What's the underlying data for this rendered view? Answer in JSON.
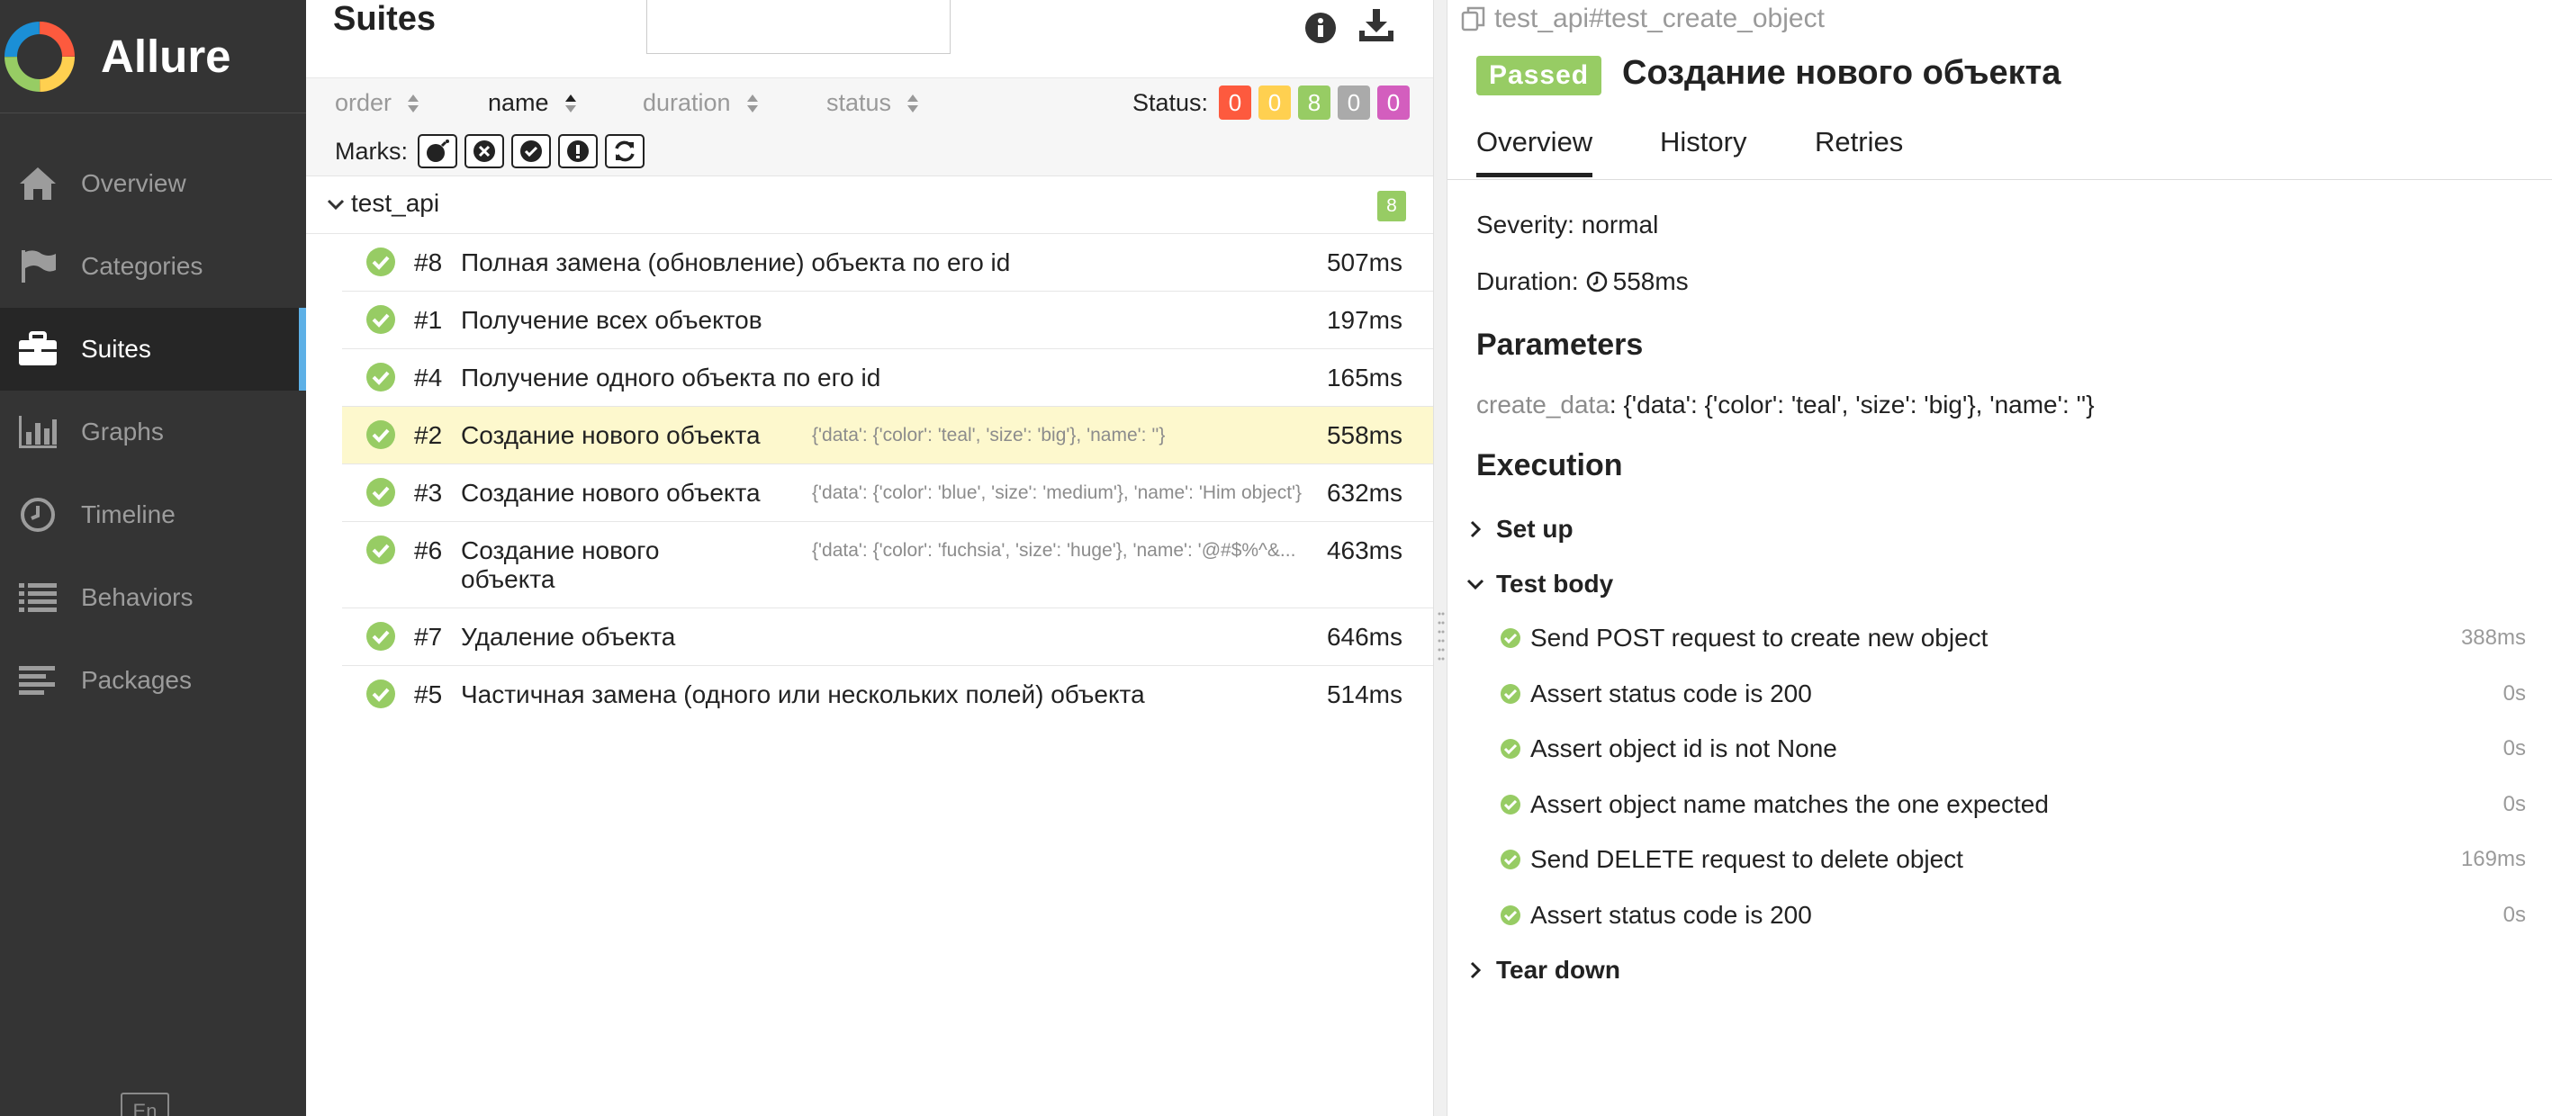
{
  "app": {
    "name": "Allure"
  },
  "sidebar": {
    "items": [
      {
        "label": "Overview",
        "icon": "home-icon",
        "active": false
      },
      {
        "label": "Categories",
        "icon": "flag-icon",
        "active": false
      },
      {
        "label": "Suites",
        "icon": "briefcase-icon",
        "active": true
      },
      {
        "label": "Graphs",
        "icon": "bar-chart-icon",
        "active": false
      },
      {
        "label": "Timeline",
        "icon": "clock-icon",
        "active": false
      },
      {
        "label": "Behaviors",
        "icon": "list-icon",
        "active": false
      },
      {
        "label": "Packages",
        "icon": "align-left-icon",
        "active": false
      }
    ],
    "language": "En"
  },
  "suites": {
    "title": "Suites",
    "sort": {
      "order": "order",
      "name": "name",
      "duration": "duration",
      "status": "status",
      "active": "name"
    },
    "status_label": "Status:",
    "status_counts": [
      {
        "key": "failed",
        "value": "0",
        "color": "#fd5a3e"
      },
      {
        "key": "broken",
        "value": "0",
        "color": "#ffd050"
      },
      {
        "key": "passed",
        "value": "8",
        "color": "#97cc64"
      },
      {
        "key": "skipped",
        "value": "0",
        "color": "#aaaaaa"
      },
      {
        "key": "unknown",
        "value": "0",
        "color": "#d35ebe"
      }
    ],
    "marks_label": "Marks:",
    "marks": [
      "flaky-bomb-icon",
      "times-circle-icon",
      "check-circle-icon",
      "exclamation-circle-icon",
      "refresh-icon"
    ],
    "group": {
      "name": "test_api",
      "count": "8"
    },
    "tests": [
      {
        "num": "#8",
        "name": "Полная замена (обновление) объекта по его id",
        "params": "",
        "duration": "507ms"
      },
      {
        "num": "#1",
        "name": "Получение всех объектов",
        "params": "",
        "duration": "197ms"
      },
      {
        "num": "#4",
        "name": "Получение одного объекта по его id",
        "params": "",
        "duration": "165ms"
      },
      {
        "num": "#2",
        "name": "Создание нового объекта",
        "params": "{'data': {'color': 'teal', 'size': 'big'}, 'name': ''}",
        "duration": "558ms",
        "selected": true
      },
      {
        "num": "#3",
        "name": "Создание нового объекта",
        "params": "{'data': {'color': 'blue', 'size': 'medium'}, 'name': 'Him object'}",
        "duration": "632ms"
      },
      {
        "num": "#6",
        "name": "Создание нового объекта",
        "params": "{'data': {'color': 'fuchsia', 'size': 'huge'}, 'name': '@#$%^&...",
        "duration": "463ms"
      },
      {
        "num": "#7",
        "name": "Удаление объекта",
        "params": "",
        "duration": "646ms"
      },
      {
        "num": "#5",
        "name": "Частичная замена (одного или нескольких полей) объекта",
        "params": "",
        "duration": "514ms"
      }
    ]
  },
  "detail": {
    "path": "test_api#test_create_object",
    "status": "Passed",
    "title": "Создание нового объекта",
    "tabs": [
      "Overview",
      "History",
      "Retries"
    ],
    "severity_label": "Severity:",
    "severity": "normal",
    "duration_label": "Duration:",
    "duration": "558ms",
    "parameters_heading": "Parameters",
    "param_key": "create_data",
    "param_value": ": {'data': {'color': 'teal', 'size': 'big'}, 'name': ''}",
    "execution_heading": "Execution",
    "setup_label": "Set up",
    "body_label": "Test body",
    "teardown_label": "Tear down",
    "steps": [
      {
        "name": "Send POST request to create new object",
        "duration": "388ms"
      },
      {
        "name": "Assert status code is 200",
        "duration": "0s"
      },
      {
        "name": "Assert object id is not None",
        "duration": "0s"
      },
      {
        "name": "Assert object name matches the one expected",
        "duration": "0s"
      },
      {
        "name": "Send DELETE request to delete object",
        "duration": "169ms"
      },
      {
        "name": "Assert status code is 200",
        "duration": "0s"
      }
    ]
  }
}
